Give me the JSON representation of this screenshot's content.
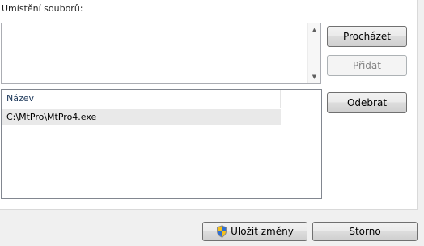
{
  "group_label": "Umístění souborů:",
  "textarea": {
    "value": ""
  },
  "listview": {
    "column_header": "Název",
    "rows": [
      "C:\\MtPro\\MtPro4.exe"
    ]
  },
  "buttons": {
    "browse": "Procházet",
    "add": "Přidat",
    "remove": "Odebrat",
    "save": "Uložit změny",
    "cancel": "Storno"
  },
  "icons": {
    "scroll_up": "scroll-up-arrow-icon",
    "scroll_down": "scroll-down-arrow-icon",
    "save": "uac-shield-icon"
  },
  "colors": {
    "shield_blue": "#2f6fd3",
    "shield_yellow": "#f5c21b"
  }
}
